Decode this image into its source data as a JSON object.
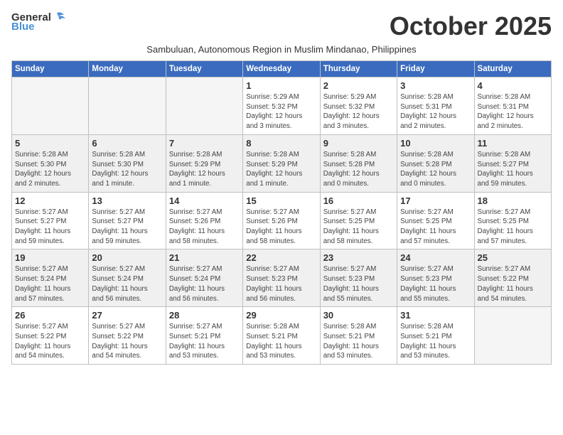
{
  "logo": {
    "general": "General",
    "blue": "Blue"
  },
  "title": "October 2025",
  "subtitle": "Sambuluan, Autonomous Region in Muslim Mindanao, Philippines",
  "days_header": [
    "Sunday",
    "Monday",
    "Tuesday",
    "Wednesday",
    "Thursday",
    "Friday",
    "Saturday"
  ],
  "weeks": [
    [
      {
        "day": "",
        "info": ""
      },
      {
        "day": "",
        "info": ""
      },
      {
        "day": "",
        "info": ""
      },
      {
        "day": "1",
        "info": "Sunrise: 5:29 AM\nSunset: 5:32 PM\nDaylight: 12 hours\nand 3 minutes."
      },
      {
        "day": "2",
        "info": "Sunrise: 5:29 AM\nSunset: 5:32 PM\nDaylight: 12 hours\nand 3 minutes."
      },
      {
        "day": "3",
        "info": "Sunrise: 5:28 AM\nSunset: 5:31 PM\nDaylight: 12 hours\nand 2 minutes."
      },
      {
        "day": "4",
        "info": "Sunrise: 5:28 AM\nSunset: 5:31 PM\nDaylight: 12 hours\nand 2 minutes."
      }
    ],
    [
      {
        "day": "5",
        "info": "Sunrise: 5:28 AM\nSunset: 5:30 PM\nDaylight: 12 hours\nand 2 minutes."
      },
      {
        "day": "6",
        "info": "Sunrise: 5:28 AM\nSunset: 5:30 PM\nDaylight: 12 hours\nand 1 minute."
      },
      {
        "day": "7",
        "info": "Sunrise: 5:28 AM\nSunset: 5:29 PM\nDaylight: 12 hours\nand 1 minute."
      },
      {
        "day": "8",
        "info": "Sunrise: 5:28 AM\nSunset: 5:29 PM\nDaylight: 12 hours\nand 1 minute."
      },
      {
        "day": "9",
        "info": "Sunrise: 5:28 AM\nSunset: 5:28 PM\nDaylight: 12 hours\nand 0 minutes."
      },
      {
        "day": "10",
        "info": "Sunrise: 5:28 AM\nSunset: 5:28 PM\nDaylight: 12 hours\nand 0 minutes."
      },
      {
        "day": "11",
        "info": "Sunrise: 5:28 AM\nSunset: 5:27 PM\nDaylight: 11 hours\nand 59 minutes."
      }
    ],
    [
      {
        "day": "12",
        "info": "Sunrise: 5:27 AM\nSunset: 5:27 PM\nDaylight: 11 hours\nand 59 minutes."
      },
      {
        "day": "13",
        "info": "Sunrise: 5:27 AM\nSunset: 5:27 PM\nDaylight: 11 hours\nand 59 minutes."
      },
      {
        "day": "14",
        "info": "Sunrise: 5:27 AM\nSunset: 5:26 PM\nDaylight: 11 hours\nand 58 minutes."
      },
      {
        "day": "15",
        "info": "Sunrise: 5:27 AM\nSunset: 5:26 PM\nDaylight: 11 hours\nand 58 minutes."
      },
      {
        "day": "16",
        "info": "Sunrise: 5:27 AM\nSunset: 5:25 PM\nDaylight: 11 hours\nand 58 minutes."
      },
      {
        "day": "17",
        "info": "Sunrise: 5:27 AM\nSunset: 5:25 PM\nDaylight: 11 hours\nand 57 minutes."
      },
      {
        "day": "18",
        "info": "Sunrise: 5:27 AM\nSunset: 5:25 PM\nDaylight: 11 hours\nand 57 minutes."
      }
    ],
    [
      {
        "day": "19",
        "info": "Sunrise: 5:27 AM\nSunset: 5:24 PM\nDaylight: 11 hours\nand 57 minutes."
      },
      {
        "day": "20",
        "info": "Sunrise: 5:27 AM\nSunset: 5:24 PM\nDaylight: 11 hours\nand 56 minutes."
      },
      {
        "day": "21",
        "info": "Sunrise: 5:27 AM\nSunset: 5:24 PM\nDaylight: 11 hours\nand 56 minutes."
      },
      {
        "day": "22",
        "info": "Sunrise: 5:27 AM\nSunset: 5:23 PM\nDaylight: 11 hours\nand 56 minutes."
      },
      {
        "day": "23",
        "info": "Sunrise: 5:27 AM\nSunset: 5:23 PM\nDaylight: 11 hours\nand 55 minutes."
      },
      {
        "day": "24",
        "info": "Sunrise: 5:27 AM\nSunset: 5:23 PM\nDaylight: 11 hours\nand 55 minutes."
      },
      {
        "day": "25",
        "info": "Sunrise: 5:27 AM\nSunset: 5:22 PM\nDaylight: 11 hours\nand 54 minutes."
      }
    ],
    [
      {
        "day": "26",
        "info": "Sunrise: 5:27 AM\nSunset: 5:22 PM\nDaylight: 11 hours\nand 54 minutes."
      },
      {
        "day": "27",
        "info": "Sunrise: 5:27 AM\nSunset: 5:22 PM\nDaylight: 11 hours\nand 54 minutes."
      },
      {
        "day": "28",
        "info": "Sunrise: 5:27 AM\nSunset: 5:21 PM\nDaylight: 11 hours\nand 53 minutes."
      },
      {
        "day": "29",
        "info": "Sunrise: 5:28 AM\nSunset: 5:21 PM\nDaylight: 11 hours\nand 53 minutes."
      },
      {
        "day": "30",
        "info": "Sunrise: 5:28 AM\nSunset: 5:21 PM\nDaylight: 11 hours\nand 53 minutes."
      },
      {
        "day": "31",
        "info": "Sunrise: 5:28 AM\nSunset: 5:21 PM\nDaylight: 11 hours\nand 53 minutes."
      },
      {
        "day": "",
        "info": ""
      }
    ]
  ]
}
